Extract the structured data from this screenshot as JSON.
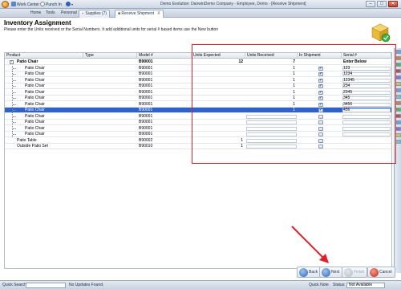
{
  "window": {
    "title": "Demo Evolution: DanwinDemo Company - Employee, Demo - [Receive Shipment]",
    "quick_access": [
      {
        "label": "Work Center"
      },
      {
        "label": "Punch In"
      }
    ],
    "controls": {
      "minimize": "–",
      "maximize": "□",
      "close": "✕"
    }
  },
  "menu": {
    "items": [
      {
        "label": "Home"
      },
      {
        "label": "Tools"
      },
      {
        "label": "Personal"
      }
    ],
    "tabs": [
      {
        "label": "Supplies (7)",
        "active": false
      },
      {
        "label": "Receive Shipment",
        "active": true,
        "close": "X"
      }
    ]
  },
  "header": {
    "title": "Inventory Assignment",
    "instructions": "Please enter the Units received or the Serial Numbers. It add additional units for serial # based items use the New button"
  },
  "grid": {
    "columns": [
      {
        "label": "Product"
      },
      {
        "label": "Type"
      },
      {
        "label": "Model #"
      },
      {
        "label": "Units Expected"
      },
      {
        "label": "Units Received"
      },
      {
        "label": "In Shipment"
      },
      {
        "label": "Serial #"
      }
    ],
    "rows": [
      {
        "level": 0,
        "expander": "-",
        "product": "Patio Chair",
        "type": "",
        "model": "B90001",
        "expected": "12",
        "received": "7",
        "shipment": "",
        "serial": "Enter Below",
        "bold": true
      },
      {
        "level": 1,
        "product": "Patio Chair",
        "model": "B90001",
        "expected": "",
        "received": "1",
        "shipment": "checked",
        "serial": "123"
      },
      {
        "level": 1,
        "product": "Patio Chair",
        "model": "B90001",
        "expected": "",
        "received": "1",
        "shipment": "checked",
        "serial": "1234"
      },
      {
        "level": 1,
        "product": "Patio Chair",
        "model": "B90001",
        "expected": "",
        "received": "1",
        "shipment": "checked",
        "serial": "12345"
      },
      {
        "level": 1,
        "product": "Patio Chair",
        "model": "B90001",
        "expected": "",
        "received": "1",
        "shipment": "checked",
        "serial": "234"
      },
      {
        "level": 1,
        "product": "Patio Chair",
        "model": "B90001",
        "expected": "",
        "received": "1",
        "shipment": "checked",
        "serial": "2345"
      },
      {
        "level": 1,
        "product": "Patio Chair",
        "model": "B90001",
        "expected": "",
        "received": "1",
        "shipment": "checked",
        "serial": "345"
      },
      {
        "level": 1,
        "product": "Patio Chair",
        "model": "B90001",
        "expected": "",
        "received": "1",
        "shipment": "checked",
        "serial": "3456"
      },
      {
        "level": 1,
        "product": "Patio Chair",
        "model": "B90001",
        "expected": "",
        "received": "1",
        "shipment": "checked",
        "serial": "456",
        "selected": true,
        "indicator": "I"
      },
      {
        "level": 1,
        "product": "Patio Chair",
        "model": "B90001",
        "expected": "",
        "received": "",
        "shipment": "empty",
        "serial": ""
      },
      {
        "level": 1,
        "product": "Patio Chair",
        "model": "B90001",
        "expected": "",
        "received": "",
        "shipment": "empty",
        "serial": ""
      },
      {
        "level": 1,
        "product": "Patio Chair",
        "model": "B90001",
        "expected": "",
        "received": "",
        "shipment": "empty",
        "serial": ""
      },
      {
        "level": 1,
        "product": "Patio Chair",
        "model": "B90001",
        "expected": "",
        "received": "",
        "shipment": "empty",
        "serial": ""
      },
      {
        "level": 0,
        "product": "Patio Table",
        "model": "B90002",
        "expected": "1",
        "received": "",
        "shipment": "empty",
        "serial": ""
      },
      {
        "level": 0,
        "product": "Outside Patio Set",
        "model": "B90010",
        "expected": "1",
        "received": "",
        "shipment": "empty",
        "serial": ""
      }
    ]
  },
  "buttons": {
    "back": "Back",
    "next": "Next",
    "finish": "Finish",
    "cancel": "Cancel"
  },
  "status": {
    "quick_search_label": "Quick Search",
    "no_updates": "No Updates Found.",
    "quick_note_label": "Quick Note",
    "status_label": "Status:",
    "status_value": "Not Available"
  },
  "colors": {
    "selection": "#2f62c6",
    "annotation": "#e0202a"
  }
}
